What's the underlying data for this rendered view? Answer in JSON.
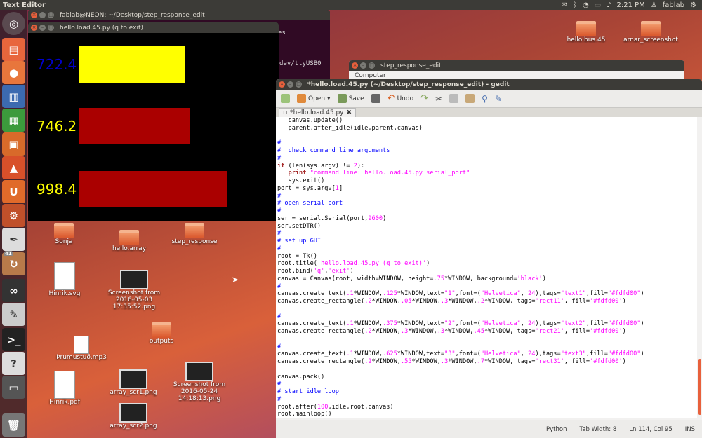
{
  "topbar": {
    "app": "Text Editor",
    "time": "2:21 PM",
    "user": "fablab"
  },
  "launcher": {
    "badge": "41"
  },
  "terminal": {
    "title": "fablab@NEON: ~/Desktop/step_response_edit",
    "fragment1": "es",
    "fragment2": "dev/ttyUSB0"
  },
  "filebrowser": {
    "title": "step_response_edit",
    "fragment": "Computer"
  },
  "graph": {
    "title": "hello.load.45.py (q to exit)",
    "rows": [
      {
        "value": "722.4",
        "text_color": "#0000cc",
        "bar_color": "#ffff00",
        "level": 0.87
      },
      {
        "value": "746.2",
        "text_color": "#fdfd00",
        "bar_color": "#aa0000",
        "level": 0.9
      },
      {
        "value": "998.4",
        "text_color": "#fdfd00",
        "bar_color": "#aa0000",
        "level": 1.21
      }
    ]
  },
  "desktop_icons": [
    {
      "label": "hello.bus.45"
    },
    {
      "label": "arnar_screenshot"
    },
    {
      "label": "Sonja"
    },
    {
      "label": "hello.array"
    },
    {
      "label": "step_response"
    },
    {
      "label": "Hinrik.svg"
    },
    {
      "label": "Screenshot from 2016-05-03 17:35:52.png"
    },
    {
      "label": "outputs"
    },
    {
      "label": "Þrumustuð.mp3"
    },
    {
      "label": "Hinrik.pdf"
    },
    {
      "label": "array_scr1.png"
    },
    {
      "label": "Screenshot from 2016-05-24 14:18:13.png"
    },
    {
      "label": "array_scr2.png"
    }
  ],
  "gedit": {
    "title": "*hello.load.45.py (~/Desktop/step_response_edit) - gedit",
    "toolbar": {
      "open": "Open",
      "save": "Save",
      "undo": "Undo"
    },
    "tab": "*hello.load.45.py",
    "status": {
      "language": "Python",
      "tabwidth": "Tab Width: 8",
      "position": "Ln 114, Col 95",
      "mode": "INS"
    },
    "lines": [
      [
        {
          "t": "   canvas.update()"
        }
      ],
      [
        {
          "t": "   parent.after_idle(idle,parent,canvas)"
        }
      ],
      [
        {
          "t": ""
        }
      ],
      [
        {
          "t": "#",
          "c": "cm"
        }
      ],
      [
        {
          "t": "#  check command line arguments",
          "c": "cm"
        }
      ],
      [
        {
          "t": "#",
          "c": "cm"
        }
      ],
      [
        {
          "t": "if",
          "c": "kw"
        },
        {
          "t": " (len(sys.argv) != "
        },
        {
          "t": "2",
          "c": "nm"
        },
        {
          "t": "):"
        }
      ],
      [
        {
          "t": "   "
        },
        {
          "t": "print",
          "c": "kw"
        },
        {
          "t": " "
        },
        {
          "t": "\"command line: hello.load.45.py serial_port\"",
          "c": "st"
        }
      ],
      [
        {
          "t": "   sys.exit()"
        }
      ],
      [
        {
          "t": "port = sys.argv["
        },
        {
          "t": "1",
          "c": "nm"
        },
        {
          "t": "]"
        }
      ],
      [
        {
          "t": "#",
          "c": "cm"
        }
      ],
      [
        {
          "t": "# open serial port",
          "c": "cm"
        }
      ],
      [
        {
          "t": "#",
          "c": "cm"
        }
      ],
      [
        {
          "t": "ser = serial.Serial(port,"
        },
        {
          "t": "9600",
          "c": "nm"
        },
        {
          "t": ")"
        }
      ],
      [
        {
          "t": "ser.setDTR()"
        }
      ],
      [
        {
          "t": "#",
          "c": "cm"
        }
      ],
      [
        {
          "t": "# set up GUI",
          "c": "cm"
        }
      ],
      [
        {
          "t": "#",
          "c": "cm"
        }
      ],
      [
        {
          "t": "root = Tk()"
        }
      ],
      [
        {
          "t": "root.title("
        },
        {
          "t": "'hello.load.45.py (q to exit)'",
          "c": "st"
        },
        {
          "t": ")"
        }
      ],
      [
        {
          "t": "root.bind("
        },
        {
          "t": "'q'",
          "c": "st"
        },
        {
          "t": ","
        },
        {
          "t": "'exit'",
          "c": "st"
        },
        {
          "t": ")"
        }
      ],
      [
        {
          "t": "canvas = Canvas(root, width=WINDOW, height="
        },
        {
          "t": ".75",
          "c": "nm"
        },
        {
          "t": "*WINDOW, background="
        },
        {
          "t": "'black'",
          "c": "st"
        },
        {
          "t": ")"
        }
      ],
      [
        {
          "t": "#",
          "c": "cm"
        }
      ],
      [
        {
          "t": "canvas.create_text("
        },
        {
          "t": ".1",
          "c": "nm"
        },
        {
          "t": "*WINDOW,"
        },
        {
          "t": ".125",
          "c": "nm"
        },
        {
          "t": "*WINDOW,text="
        },
        {
          "t": "\"1\"",
          "c": "st"
        },
        {
          "t": ",font=("
        },
        {
          "t": "\"Helvetica\"",
          "c": "st"
        },
        {
          "t": ", "
        },
        {
          "t": "24",
          "c": "nm"
        },
        {
          "t": "),tags="
        },
        {
          "t": "\"text1\"",
          "c": "st"
        },
        {
          "t": ",fill="
        },
        {
          "t": "\"#fdfd00\"",
          "c": "st"
        },
        {
          "t": ")"
        }
      ],
      [
        {
          "t": "canvas.create_rectangle("
        },
        {
          "t": ".2",
          "c": "nm"
        },
        {
          "t": "*WINDOW,"
        },
        {
          "t": ".05",
          "c": "nm"
        },
        {
          "t": "*WINDOW,"
        },
        {
          "t": ".3",
          "c": "nm"
        },
        {
          "t": "*WINDOW,"
        },
        {
          "t": ".2",
          "c": "nm"
        },
        {
          "t": "*WINDOW, tags="
        },
        {
          "t": "'rect11'",
          "c": "st"
        },
        {
          "t": ", fill="
        },
        {
          "t": "'#fdfd00'",
          "c": "st"
        },
        {
          "t": ")"
        }
      ],
      [
        {
          "t": ""
        }
      ],
      [
        {
          "t": "#",
          "c": "cm"
        }
      ],
      [
        {
          "t": "canvas.create_text("
        },
        {
          "t": ".1",
          "c": "nm"
        },
        {
          "t": "*WINDOW,"
        },
        {
          "t": ".375",
          "c": "nm"
        },
        {
          "t": "*WINDOW,text="
        },
        {
          "t": "\"2\"",
          "c": "st"
        },
        {
          "t": ",font=("
        },
        {
          "t": "\"Helvetica\"",
          "c": "st"
        },
        {
          "t": ", "
        },
        {
          "t": "24",
          "c": "nm"
        },
        {
          "t": "),tags="
        },
        {
          "t": "\"text2\"",
          "c": "st"
        },
        {
          "t": ",fill="
        },
        {
          "t": "\"#fdfd00\"",
          "c": "st"
        },
        {
          "t": ")"
        }
      ],
      [
        {
          "t": "canvas.create_rectangle("
        },
        {
          "t": ".2",
          "c": "nm"
        },
        {
          "t": "*WINDOW,"
        },
        {
          "t": ".3",
          "c": "nm"
        },
        {
          "t": "*WINDOW,"
        },
        {
          "t": ".3",
          "c": "nm"
        },
        {
          "t": "*WINDOW,"
        },
        {
          "t": ".45",
          "c": "nm"
        },
        {
          "t": "*WINDOW, tags="
        },
        {
          "t": "'rect21'",
          "c": "st"
        },
        {
          "t": ", fill="
        },
        {
          "t": "'#fdfd00'",
          "c": "st"
        },
        {
          "t": ")"
        }
      ],
      [
        {
          "t": ""
        }
      ],
      [
        {
          "t": "#",
          "c": "cm"
        }
      ],
      [
        {
          "t": "canvas.create_text("
        },
        {
          "t": ".1",
          "c": "nm"
        },
        {
          "t": "*WINDOW,"
        },
        {
          "t": ".625",
          "c": "nm"
        },
        {
          "t": "*WINDOW,text="
        },
        {
          "t": "\"3\"",
          "c": "st"
        },
        {
          "t": ",font=("
        },
        {
          "t": "\"Helvetica\"",
          "c": "st"
        },
        {
          "t": ", "
        },
        {
          "t": "24",
          "c": "nm"
        },
        {
          "t": "),tags="
        },
        {
          "t": "\"text3\"",
          "c": "st"
        },
        {
          "t": ",fill="
        },
        {
          "t": "\"#fdfd00\"",
          "c": "st"
        },
        {
          "t": ")"
        }
      ],
      [
        {
          "t": "canvas.create_rectangle("
        },
        {
          "t": ".2",
          "c": "nm"
        },
        {
          "t": "*WINDOW,"
        },
        {
          "t": ".55",
          "c": "nm"
        },
        {
          "t": "*WINDOW,"
        },
        {
          "t": ".3",
          "c": "nm"
        },
        {
          "t": "*WINDOW,"
        },
        {
          "t": ".7",
          "c": "nm"
        },
        {
          "t": "*WINDOW, tags="
        },
        {
          "t": "'rect31'",
          "c": "st"
        },
        {
          "t": ", fill="
        },
        {
          "t": "'#fdfd00'",
          "c": "st"
        },
        {
          "t": ")"
        }
      ],
      [
        {
          "t": ""
        }
      ],
      [
        {
          "t": "canvas.pack()"
        }
      ],
      [
        {
          "t": "#",
          "c": "cm"
        }
      ],
      [
        {
          "t": "# start idle loop",
          "c": "cm"
        }
      ],
      [
        {
          "t": "#",
          "c": "cm"
        }
      ],
      [
        {
          "t": "root.after("
        },
        {
          "t": "100",
          "c": "nm"
        },
        {
          "t": ",idle,root,canvas)"
        }
      ],
      [
        {
          "t": "root.mainloop()"
        }
      ]
    ]
  }
}
